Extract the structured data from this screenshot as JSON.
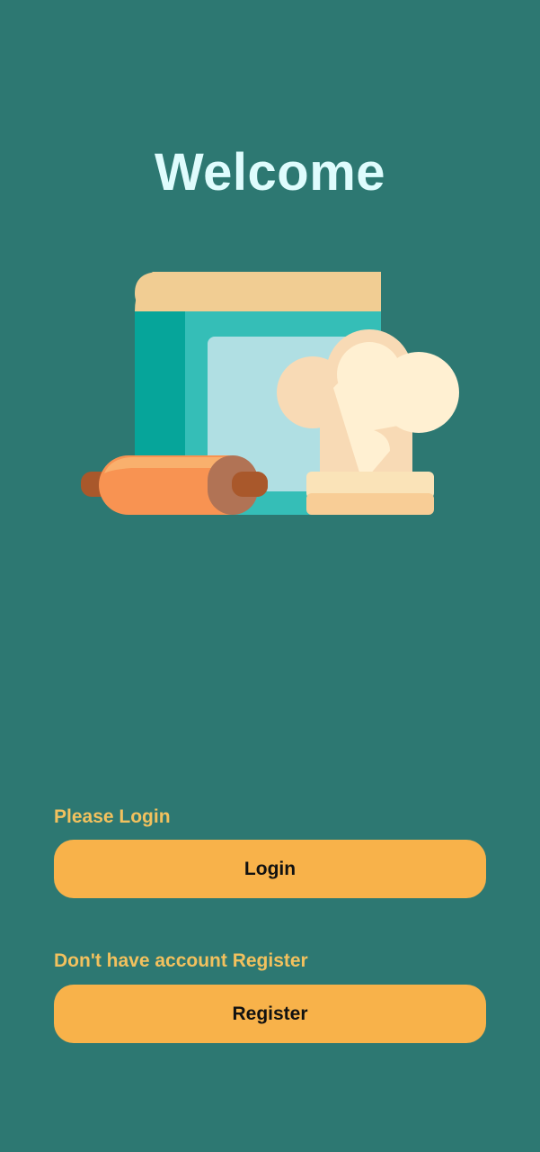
{
  "header": {
    "title": "Welcome"
  },
  "login_section": {
    "prompt": "Please Login",
    "button_label": "Login"
  },
  "register_section": {
    "prompt": "Don't have account Register",
    "button_label": "Register"
  },
  "illustration": {
    "icons": [
      "cookbook-icon",
      "rolling-pin-icon",
      "chef-hat-icon"
    ]
  },
  "colors": {
    "background": "#2d7872",
    "title": "#dffcfd",
    "prompt": "#f2c15e",
    "button": "#f8b24a",
    "button_text": "#111111"
  }
}
